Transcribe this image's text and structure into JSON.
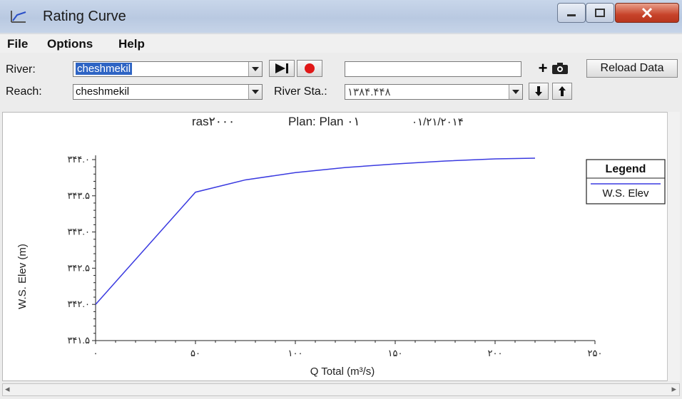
{
  "window": {
    "title": "Rating Curve",
    "min_label": "–",
    "max_label": "☐",
    "close_label": "✕"
  },
  "menu": {
    "items": [
      "File",
      "Options",
      "Help"
    ]
  },
  "toolbar": {
    "river_label": "River:",
    "river_value": "cheshmekil",
    "reach_label": "Reach:",
    "reach_value": "cheshmekil",
    "river_sta_label": "River Sta.:",
    "river_sta_value": "۱۳۸۴.۴۴۸",
    "plus_label": "+",
    "reload_label": "Reload Data"
  },
  "plot": {
    "header_left": "ras۲۰۰۰",
    "header_plan": "Plan: Plan ۰۱",
    "header_date": "۰۱/۲۱/۲۰۱۴"
  },
  "chart_data": {
    "type": "line",
    "xlabel": "Q Total  (m³/s)",
    "ylabel": "W.S. Elev  (m)",
    "xlim": [
      0,
      250
    ],
    "ylim": [
      341.5,
      344.0
    ],
    "x_ticks": [
      0,
      50,
      100,
      150,
      200,
      250
    ],
    "y_ticks": [
      341.5,
      342.0,
      342.5,
      343.0,
      343.5,
      344.0
    ],
    "x_tick_labels": [
      "۰",
      "۵۰",
      "۱۰۰",
      "۱۵۰",
      "۲۰۰",
      "۲۵۰"
    ],
    "y_tick_labels": [
      "۳۴۱.۵",
      "۳۴۲.۰",
      "۳۴۲.۵",
      "۳۴۳.۰",
      "۳۴۳.۵",
      "۳۴۴.۰"
    ],
    "legend_title": "Legend",
    "legend_position": "top-right",
    "series": [
      {
        "name": "W.S. Elev",
        "color": "#3a3ae0",
        "x": [
          0,
          50,
          75,
          100,
          125,
          150,
          175,
          200,
          220
        ],
        "y": [
          342.0,
          343.55,
          343.72,
          343.82,
          343.89,
          343.94,
          343.98,
          344.01,
          344.02
        ]
      }
    ]
  },
  "status": {
    "scroll_left": "◂",
    "scroll_right": "▸"
  }
}
